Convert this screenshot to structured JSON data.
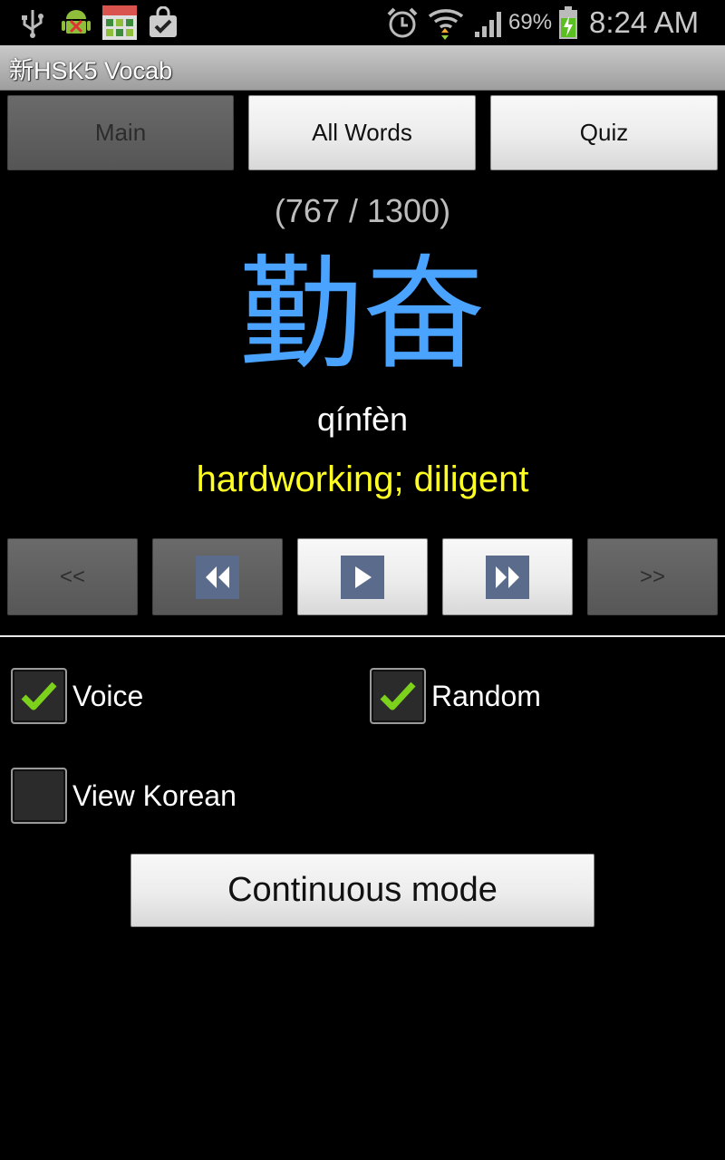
{
  "status_bar": {
    "icons": [
      "usb-icon",
      "android-debug-icon",
      "calendar-icon",
      "shopping-bag-icon",
      "alarm-icon",
      "wifi-icon",
      "signal-icon",
      "battery-charging-icon"
    ],
    "battery": "69%",
    "time": "8:24 AM"
  },
  "app": {
    "title": "新HSK5 Vocab"
  },
  "tabs": {
    "main": "Main",
    "all_words": "All Words",
    "quiz": "Quiz"
  },
  "card": {
    "counter": "(767 / 1300)",
    "hanzi": "勤奋",
    "pinyin": "qínfèn",
    "meaning": "hardworking; diligent"
  },
  "nav": {
    "first": "<<",
    "last": ">>",
    "prev_icon": "rewind-icon",
    "play_icon": "play-icon",
    "next_icon": "fast-forward-icon"
  },
  "options": {
    "voice": {
      "label": "Voice",
      "checked": true
    },
    "random": {
      "label": "Random",
      "checked": true
    },
    "view_korean": {
      "label": "View Korean",
      "checked": false
    }
  },
  "continuous_mode_label": "Continuous mode",
  "colors": {
    "hanzi": "#4aa3ff",
    "meaning": "#ffff22",
    "check": "#7cd11d",
    "nav_icon_bg": "#5a6b8c"
  }
}
